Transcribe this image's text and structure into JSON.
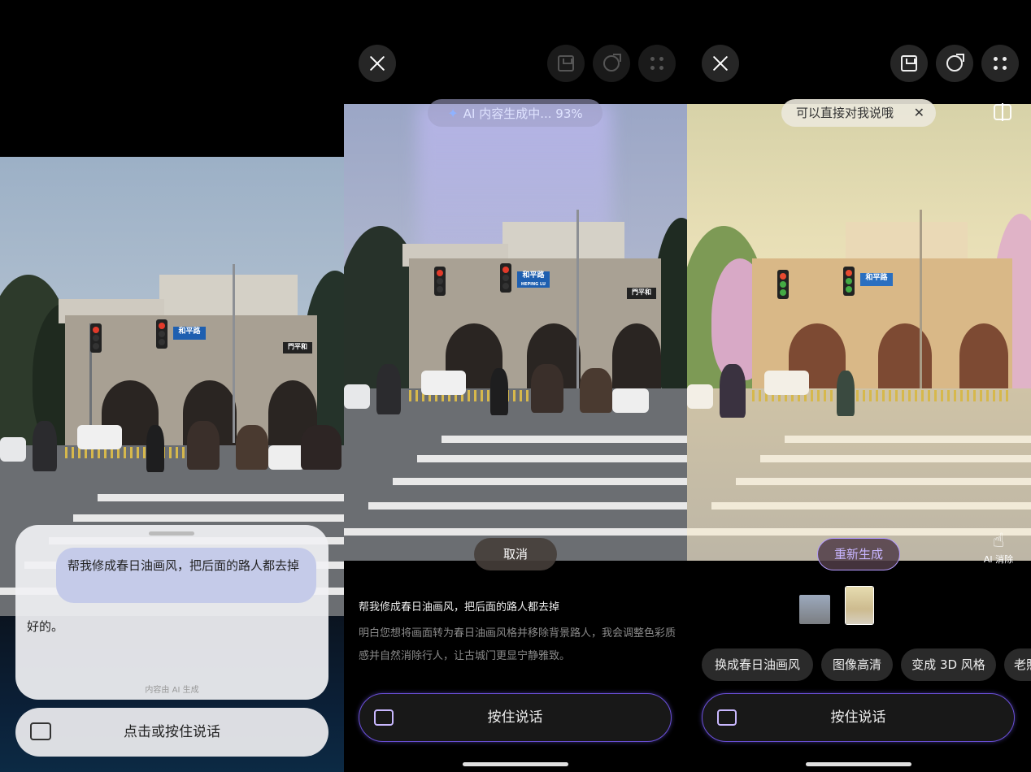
{
  "panel1": {
    "chat": {
      "user_message": "帮我修成春日油画风，把后面的路人都去掉",
      "assistant_reply": "好的。",
      "ai_source_note": "内容由 AI 生成"
    },
    "voice_button_label": "点击或按住说话",
    "sign_text": "和平路",
    "sign_text_small": "門平和"
  },
  "panel2": {
    "progress_label": "AI 内容生成中... 93%",
    "progress_percent": 93,
    "cancel_label": "取消",
    "prompt": "帮我修成春日油画风，把后面的路人都去掉",
    "description": "明白您想将画面转为春日油画风格并移除背景路人，我会调整色彩质感并自然消除行人，让古城门更显宁静雅致。",
    "hold_to_talk_label": "按住说话",
    "sign_text": "和平路",
    "sign_sub": "HEPING LU",
    "sign_text_small": "門平和"
  },
  "panel3": {
    "tip_label": "可以直接对我说哦",
    "regenerate_label": "重新生成",
    "ai_erase_label": "AI 消除",
    "chips": [
      "换成春日油画风",
      "图像高清",
      "变成 3D 风格",
      "老照片"
    ],
    "hold_to_talk_label": "按住说话",
    "sign_text": "和平路"
  },
  "icons": [
    "close-icon",
    "save-icon",
    "share-icon",
    "more-dots-icon",
    "keyboard-icon",
    "sparkle-icon",
    "compare-icon",
    "eraser-hand-icon"
  ],
  "colors": {
    "accent_purple": "#6a4fd6",
    "regen_text": "#c8b5ff",
    "user_bubble": "#c5cbe9",
    "progress_text": "#dfe3ff"
  }
}
